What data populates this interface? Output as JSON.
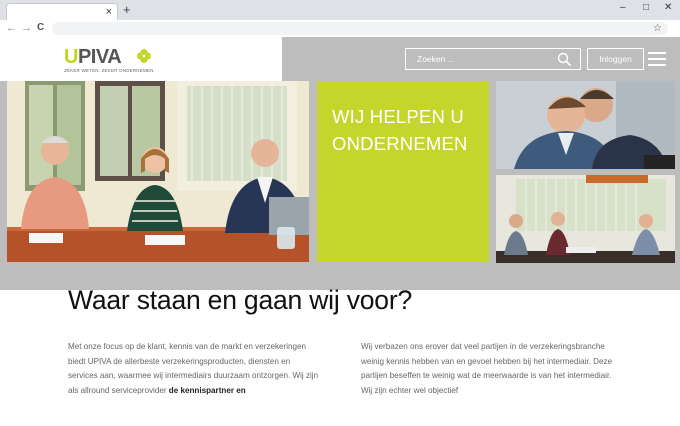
{
  "browser": {
    "tab_close": "×",
    "new_tab": "+",
    "minimize": "–",
    "maximize": "□",
    "close": "✕",
    "back": "←",
    "forward": "→",
    "reload": "C",
    "bookmark": "☆"
  },
  "header": {
    "logo_u": "U",
    "logo_rest": "PIVA",
    "logo_tagline": "ZÉKER WETEN. ZÉKER ONDERNEMEN.",
    "search_placeholder": "Zoeken ...",
    "login_label": "Inloggen"
  },
  "hero": {
    "slogan_line1": "WIJ HELPEN U",
    "slogan_line2": "ONDERNEMEN"
  },
  "colors": {
    "brand_green": "#c5d52b",
    "header_gray": "#bdbdbd"
  },
  "content": {
    "heading": "Waar staan en gaan wij voor?",
    "left_paragraph": "Met onze focus op de klant, kennis van de markt en verzekeringen biedt UPIVA de allerbeste verzekeringsproducten, diensten en services aan, waarmee wij intermediairs duurzaam ontzorgen. Wij zijn als allround serviceprovider",
    "left_paragraph_bold": "de kennispartner en",
    "right_paragraph": "Wij verbazen ons erover dat veel partijen in de verzekeringsbranche weinig kennis hebben van en gevoel hebben bij het intermediair. Deze partijen beseffen te weinig wat de meerwaarde is van het intermediair. Wij zijn echter wel objectief"
  }
}
